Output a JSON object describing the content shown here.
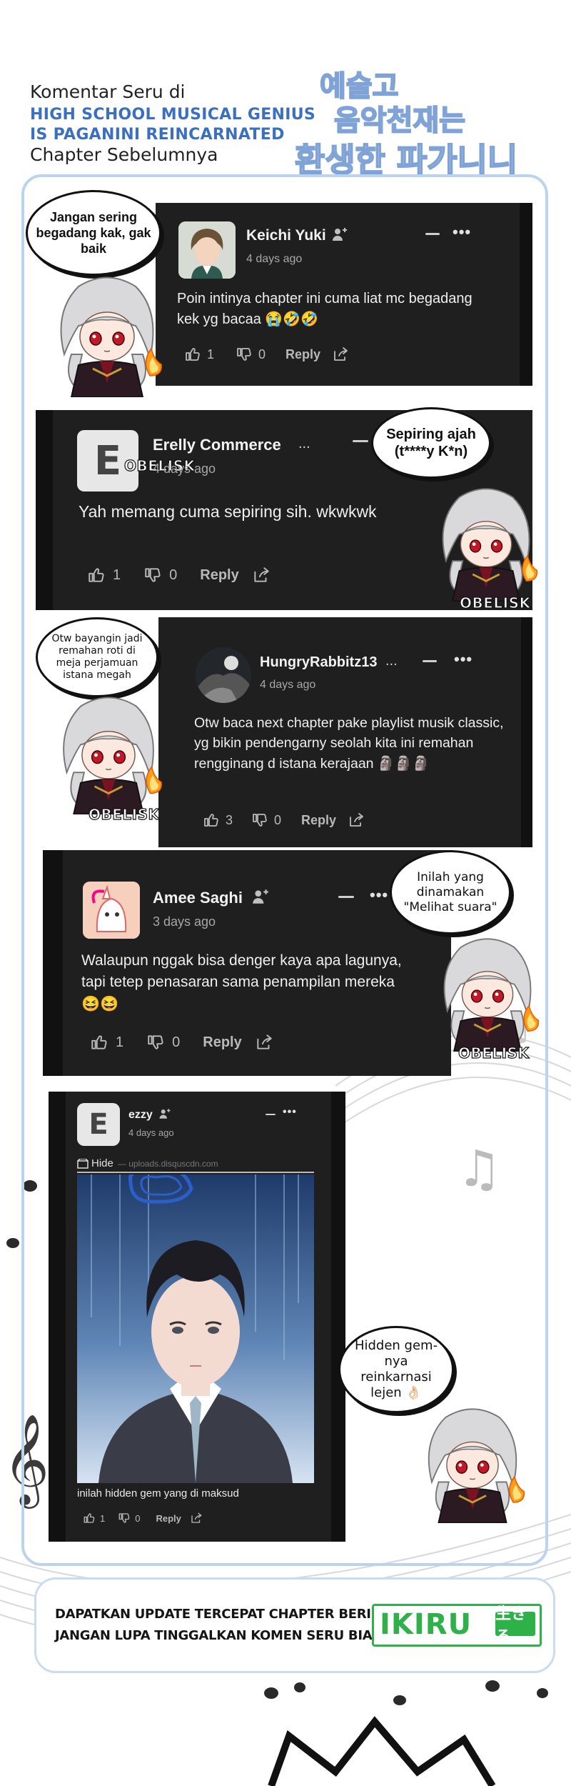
{
  "header": {
    "line1": "Komentar Seru di",
    "line2": "HIGH SCHOOL MUSICAL GENIUS",
    "line3": "IS PAGANINI REINCARNATED",
    "line4": "Chapter Sebelumnya",
    "logo_line1": "예술고",
    "logo_line2": "음악천재는",
    "logo_line3": "환생한 파가니니"
  },
  "comments": [
    {
      "username": "Keichi Yuki",
      "date": "4 days ago",
      "text": "Poin intinya chapter ini cuma liat mc begadang kek yg bacaa 😭🤣🤣",
      "likes": "1",
      "dislikes": "0",
      "reply_label": "Reply",
      "bubble": "Jangan sering begadang kak, gak baik"
    },
    {
      "username": "Erelly Commerce",
      "username_suffix": "...",
      "date": "4 days ago",
      "avatar_letter": "E",
      "watermark": "OBELISK",
      "text": "Yah memang cuma sepiring sih. wkwkwk",
      "likes": "1",
      "dislikes": "0",
      "reply_label": "Reply",
      "bubble": "Sepiring ajah (t****y K*n)"
    },
    {
      "username": "HungryRabbitz13",
      "username_suffix": "...",
      "date": "4 days ago",
      "text": "Otw baca next chapter pake playlist musik classic, yg bikin pendengarny seolah kita ini remahan rengginang d istana kerajaan 🗿🗿🗿",
      "likes": "3",
      "dislikes": "0",
      "reply_label": "Reply",
      "bubble": "Otw bayangin jadi remahan roti di meja perjamuan istana megah"
    },
    {
      "username": "Amee Saghi",
      "date": "3 days ago",
      "text": "Walaupun nggak bisa denger kaya apa lagunya, tapi tetep penasaran sama penampilan mereka 😆😆",
      "likes": "1",
      "dislikes": "0",
      "reply_label": "Reply",
      "bubble": "Inilah yang dinamakan \"Melihat suara\""
    },
    {
      "username": "ezzy",
      "date": "4 days ago",
      "avatar_letter": "E",
      "hide_label": "Hide",
      "image_source": "— uploads.disquscdn.com",
      "caption": "inilah hidden gem yang di maksud",
      "likes": "1",
      "dislikes": "0",
      "reply_label": "Reply",
      "bubble": "Hidden gem-nya reinkarnasi lejen 👌🏻"
    }
  ],
  "mascot_tag": "OBELISK",
  "footer": {
    "line1": "DAPATKAN UPDATE TERCEPAT CHAPTER BERIKUTNYA DI",
    "line2": "JANGAN LUPA TINGGALKAN KOMEN SERU BIAR DI NOTIS",
    "brand": "IKIRU",
    "brand_kanji": "生きる"
  },
  "colors": {
    "card_bg": "#1f1f1f",
    "frame_border": "#bcd3ee",
    "title_blue": "#3b6fbf",
    "brand_green": "#2fb14a"
  }
}
